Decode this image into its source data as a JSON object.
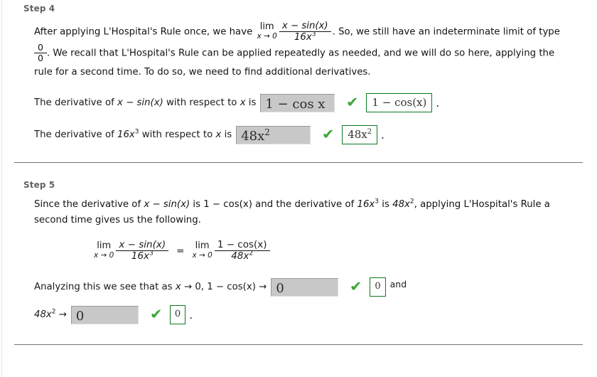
{
  "document": {
    "type": "math-homework-solution",
    "accent_green": "#0a7a22",
    "check_green": "#3aa83a",
    "input_fill": "#c8c8c8"
  },
  "step4": {
    "title": "Step 4",
    "paragraph": {
      "lead": "After applying L'Hospital's Rule once, we have",
      "limit": {
        "op": "lim",
        "sub": "x → 0",
        "numerator": "x − sin(x)",
        "denominator": "16x",
        "denominator_exp": "3"
      },
      "after_limit": ". So, we still have an indeterminate limit of type",
      "indeterminate_num": "0",
      "indeterminate_den": "0",
      "continuation": ". We recall that L'Hospital's Rule can be applied repeatedly as needed, and we will do so here, applying the",
      "line3": "rule for a second time. To do so, we need to find additional derivatives."
    },
    "answers": [
      {
        "label_pre": "The derivative of",
        "label_expr": "x − sin(x)",
        "label_mid": "with respect to",
        "label_var": "x",
        "label_post": "is",
        "input_value": "1 − cos  x",
        "status": "correct",
        "check_icon": "green-check-icon",
        "solution": "1 − cos(x)",
        "trailing": "."
      },
      {
        "label_pre": "The derivative of",
        "label_expr": "16x",
        "label_expr_exp": "3",
        "label_mid": "with respect to",
        "label_var": "x",
        "label_post": "is",
        "input_value": "48x",
        "input_value_exp": "2",
        "status": "correct",
        "check_icon": "green-check-icon",
        "solution": "48x",
        "solution_exp": "2",
        "trailing": "."
      }
    ]
  },
  "step5": {
    "title": "Step 5",
    "paragraph": {
      "line1_a": "Since the derivative of",
      "line1_expr1": "x − sin(x)",
      "line1_b": "is",
      "line1_expr2": "1 − cos(x)",
      "line1_c": "and the derivative of",
      "line1_expr3": "16x",
      "line1_expr3_exp": "3",
      "line1_d": "is",
      "line1_expr4": "48x",
      "line1_expr4_exp": "2",
      "line1_e": ", applying L'Hospital's Rule a",
      "line2": "second time gives us the following."
    },
    "equation": {
      "left": {
        "op": "lim",
        "sub": "x → 0",
        "numerator": "x − sin(x)",
        "denominator": "16x",
        "denominator_exp": "3"
      },
      "relation": "=",
      "right": {
        "op": "lim",
        "sub": "x → 0",
        "numerator": "1 − cos(x)",
        "denominator": "48x",
        "denominator_exp": "2"
      }
    },
    "answers": [
      {
        "label_pre": "Analyzing this we see that as",
        "label_var": "x",
        "label_arrow1": "→ 0,",
        "label_expr": "1 − cos(x)",
        "label_arrow2": "→",
        "input_value": "0",
        "status": "correct",
        "check_icon": "green-check-icon",
        "solution": "0",
        "trailing_word": "and"
      },
      {
        "label_expr": "48x",
        "label_expr_exp": "2",
        "label_arrow": "→",
        "input_value": "0",
        "status": "correct",
        "check_icon": "green-check-icon",
        "solution": "0",
        "trailing": "."
      }
    ]
  }
}
